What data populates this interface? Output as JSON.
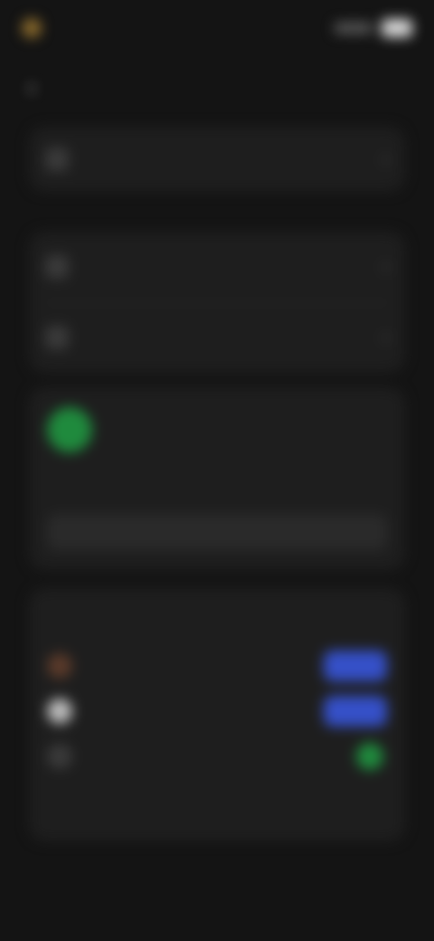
{
  "status_bar": {
    "time": ""
  },
  "header": {
    "title": "",
    "back_icon": "chevron-left-icon"
  },
  "rows_top": [
    {
      "label": "",
      "icon": ""
    }
  ],
  "rows_mid": [
    {
      "label": "",
      "icon": ""
    },
    {
      "label": "",
      "icon": ""
    }
  ],
  "update": {
    "title": "",
    "description": "",
    "button_label": ""
  },
  "connections": {
    "title": "",
    "items": [
      {
        "label": "",
        "icon": "",
        "status": "connected"
      },
      {
        "label": "",
        "icon": "",
        "status": "connected"
      },
      {
        "label": "",
        "icon": "",
        "status": "ok"
      }
    ],
    "note": ""
  },
  "colors": {
    "background": "#141414",
    "card": "#1e1e1e",
    "accent_blue": "#3550c8",
    "accent_green": "#1f8a3d"
  }
}
